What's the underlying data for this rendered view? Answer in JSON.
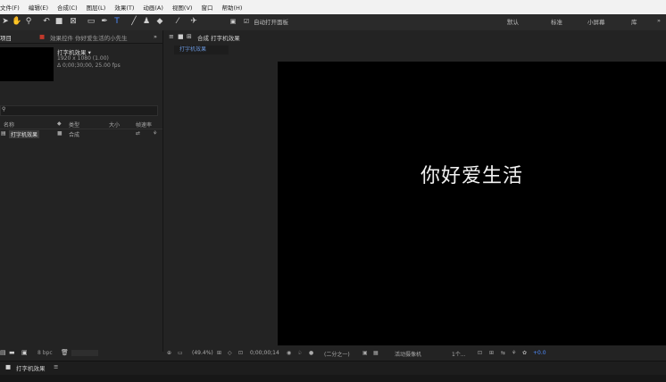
{
  "menubar": {
    "items": [
      "文件(F)",
      "编辑(E)",
      "合成(C)",
      "图层(L)",
      "效果(T)",
      "动画(A)",
      "视图(V)",
      "窗口",
      "帮助(H)"
    ]
  },
  "toolbar": {
    "auto_open_panel": "自动打开面板",
    "workspaces": [
      "默认",
      "标准",
      "小屏幕",
      "库"
    ]
  },
  "project": {
    "tab_label": "项目",
    "effects_tab": "效果控件 你好爱生活的小先生",
    "comp_name": "打字机效果 ▾",
    "comp_size": "1920 x 1080 (1.00)",
    "comp_duration": "Δ 0;00;30;00, 25.00 fps",
    "columns": {
      "name": "名称",
      "type": "类型",
      "size": "大小",
      "fps": "帧速率"
    },
    "row": {
      "name": "打字机效果",
      "type": "合成"
    },
    "bpc": "8 bpc"
  },
  "comp": {
    "panel_title": "合成 打字机效果",
    "tab": "打字机效果",
    "viewer_text": "你好爱生活",
    "zoom": "(49.4%)",
    "timecode": "0;00;00;14",
    "resolution": "(二分之一)",
    "camera": "活动摄像机",
    "views": "1个...",
    "exposure": "+0.0"
  },
  "timeline": {
    "tab": "打字机效果"
  }
}
